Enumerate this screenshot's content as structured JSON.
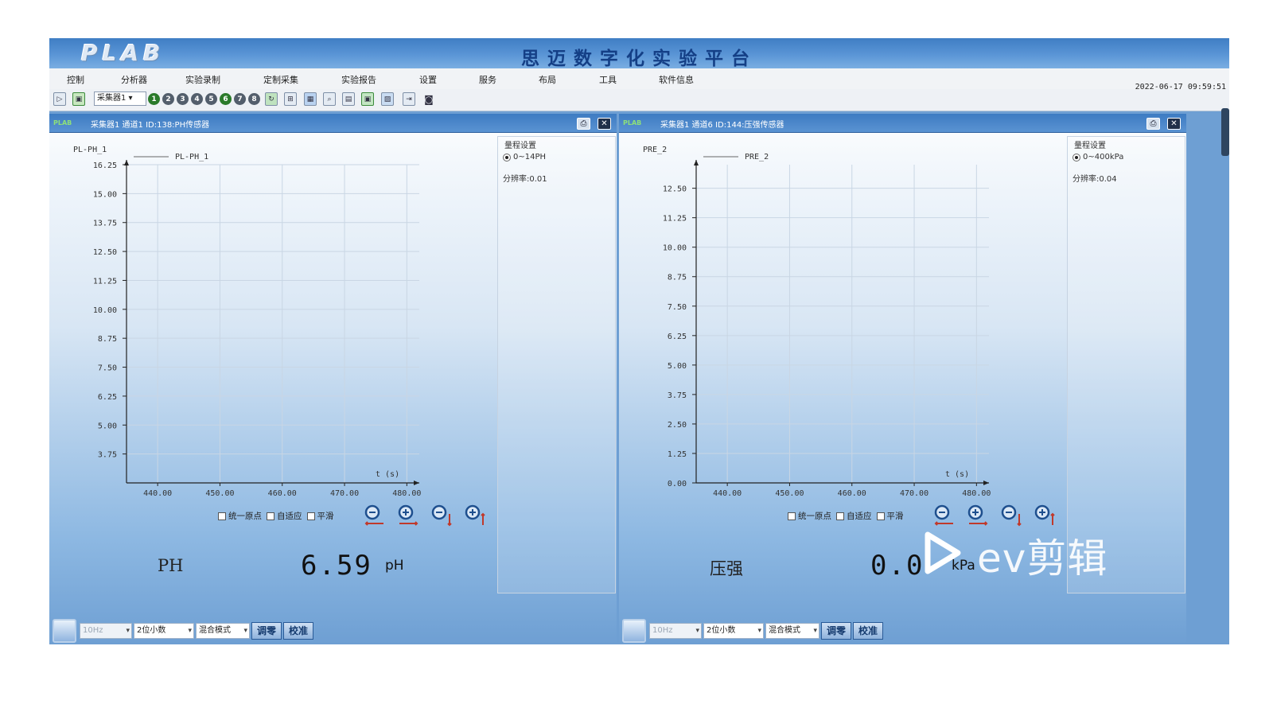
{
  "app": {
    "logo_text": "PLAB",
    "title": "思迈数字化实验平台",
    "datetime": "2022-06-17 09:59:51"
  },
  "menu": {
    "items": [
      "控制",
      "分析器",
      "实验录制",
      "定制采集",
      "实验报告",
      "设置",
      "服务",
      "布局",
      "工具",
      "软件信息"
    ]
  },
  "toolbar": {
    "collector_select": "采集器1",
    "channel_numbers": [
      "1",
      "2",
      "3",
      "4",
      "5",
      "6",
      "7",
      "8"
    ]
  },
  "panels": [
    {
      "title": "采集器1  通道1  ID:138:PH传感器",
      "mini_logo": "PLAB",
      "chart_data": {
        "type": "line",
        "series": [
          {
            "name": "PL-PH_1",
            "values": []
          }
        ],
        "ylabel": "PL-PH_1",
        "legend": "PL-PH_1",
        "xlabel": "t (s)",
        "yticks": [
          "16.25",
          "15.00",
          "13.75",
          "12.50",
          "11.25",
          "10.00",
          "8.75",
          "7.50",
          "6.25",
          "5.00",
          "3.75"
        ],
        "xticks": [
          "440.00",
          "450.00",
          "460.00",
          "470.00",
          "480.00"
        ],
        "xlim": [
          435,
          482
        ],
        "ylim": [
          2.5,
          16.25
        ],
        "grid": true
      },
      "range_title": "量程设置",
      "range_option": "0~14PH",
      "resolution": "分辨率:0.01",
      "options": [
        "统一原点",
        "自适应",
        "平滑"
      ],
      "readout": {
        "name": "PH",
        "value": "6.59",
        "unit": "pH"
      },
      "bottom": {
        "freq": "10Hz",
        "decimals": "2位小数",
        "mode": "混合模式",
        "zero_button": "调零",
        "calibrate_button": "校准"
      }
    },
    {
      "title": "采集器1  通道6  ID:144:压强传感器",
      "mini_logo": "PLAB",
      "chart_data": {
        "type": "line",
        "series": [
          {
            "name": "PRE_2",
            "values": []
          }
        ],
        "ylabel": "PRE_2",
        "legend": "PRE_2",
        "xlabel": "t (s)",
        "yticks": [
          "12.50",
          "11.25",
          "10.00",
          "8.75",
          "7.50",
          "6.25",
          "5.00",
          "3.75",
          "2.50",
          "1.25",
          "0.00"
        ],
        "xticks": [
          "440.00",
          "450.00",
          "460.00",
          "470.00",
          "480.00"
        ],
        "xlim": [
          435,
          482
        ],
        "ylim": [
          0,
          13.5
        ],
        "grid": true
      },
      "range_title": "量程设置",
      "range_option": "0~400kPa",
      "resolution": "分辨率:0.04",
      "options": [
        "统一原点",
        "自适应",
        "平滑"
      ],
      "readout": {
        "name": "压强",
        "value": "0.0",
        "unit": "kPa"
      },
      "bottom": {
        "freq": "10Hz",
        "decimals": "2位小数",
        "mode": "混合模式",
        "zero_button": "调零",
        "calibrate_button": "校准"
      }
    }
  ],
  "watermark": {
    "text": "ev剪辑"
  },
  "colors": {
    "title_bar": "#3f7ec4",
    "panel_bottom": "#6e9fd3",
    "title_text": "#143f86"
  }
}
